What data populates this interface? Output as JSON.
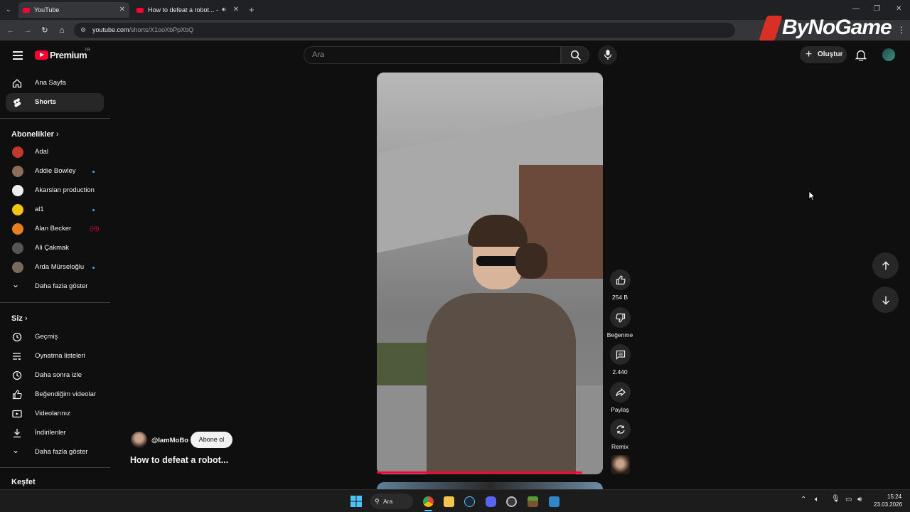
{
  "browser": {
    "tabs": [
      {
        "title": "YouTube"
      },
      {
        "title": "How to defeat a robot... - Yo"
      }
    ],
    "url_host": "youtube.com",
    "url_path": "/shorts/X1ooXbPpXbQ",
    "watermark": "ByNoGame"
  },
  "header": {
    "logo_text": "Premium",
    "logo_region": "TR",
    "search_placeholder": "Ara",
    "create_label": "Oluştur"
  },
  "sidebar": {
    "main": [
      {
        "label": "Ana Sayfa",
        "icon": "home-icon"
      },
      {
        "label": "Shorts",
        "icon": "shorts-icon",
        "active": true
      }
    ],
    "subscriptions_title": "Abonelikler",
    "subscriptions": [
      {
        "label": "Adal",
        "avatar_color": "#c0392b"
      },
      {
        "label": "Addie Bowley",
        "avatar_color": "#8e6d5a",
        "new": true
      },
      {
        "label": "Akarslan production",
        "avatar_color": "#eeeeee"
      },
      {
        "label": "al1",
        "avatar_color": "#f1c40f",
        "new": true
      },
      {
        "label": "Alan Becker",
        "avatar_color": "#e67e22",
        "live": "((•))"
      },
      {
        "label": "Ali Çakmak",
        "avatar_color": "#555555"
      },
      {
        "label": "Arda Mürseloğlu",
        "avatar_color": "#7a6a5a",
        "new": true
      }
    ],
    "subscriptions_more": "Daha fazla göster",
    "you_title": "Siz",
    "you": [
      {
        "label": "Geçmiş",
        "icon": "history-icon"
      },
      {
        "label": "Oynatma listeleri",
        "icon": "playlists-icon"
      },
      {
        "label": "Daha sonra izle",
        "icon": "clock-icon"
      },
      {
        "label": "Beğendiğim videolar",
        "icon": "thumbs-up-icon"
      },
      {
        "label": "Videolarınız",
        "icon": "your-videos-icon"
      },
      {
        "label": "İndirilenler",
        "icon": "download-icon"
      }
    ],
    "you_more": "Daha fazla göster",
    "explore_title": "Keşfet"
  },
  "short": {
    "channel": "@IamMoBo",
    "subscribe_label": "Abone ol",
    "title": "How to defeat a robot...",
    "progress_fraction": 0.91,
    "actions": [
      {
        "name": "like",
        "label": "254 B",
        "icon": "thumbs-up-icon"
      },
      {
        "name": "dislike",
        "label": "Beğenme",
        "icon": "thumbs-down-icon"
      },
      {
        "name": "comments",
        "label": "2.440",
        "icon": "comment-icon"
      },
      {
        "name": "share",
        "label": "Paylaş",
        "icon": "share-icon"
      },
      {
        "name": "remix",
        "label": "Remix",
        "icon": "remix-icon"
      }
    ]
  },
  "taskbar": {
    "search_label": "Ara",
    "time": "15:24",
    "date": "23.03.2026"
  },
  "colors": {
    "brand_red": "#ff0033",
    "background": "#0f0f0f",
    "surface": "#272727"
  }
}
